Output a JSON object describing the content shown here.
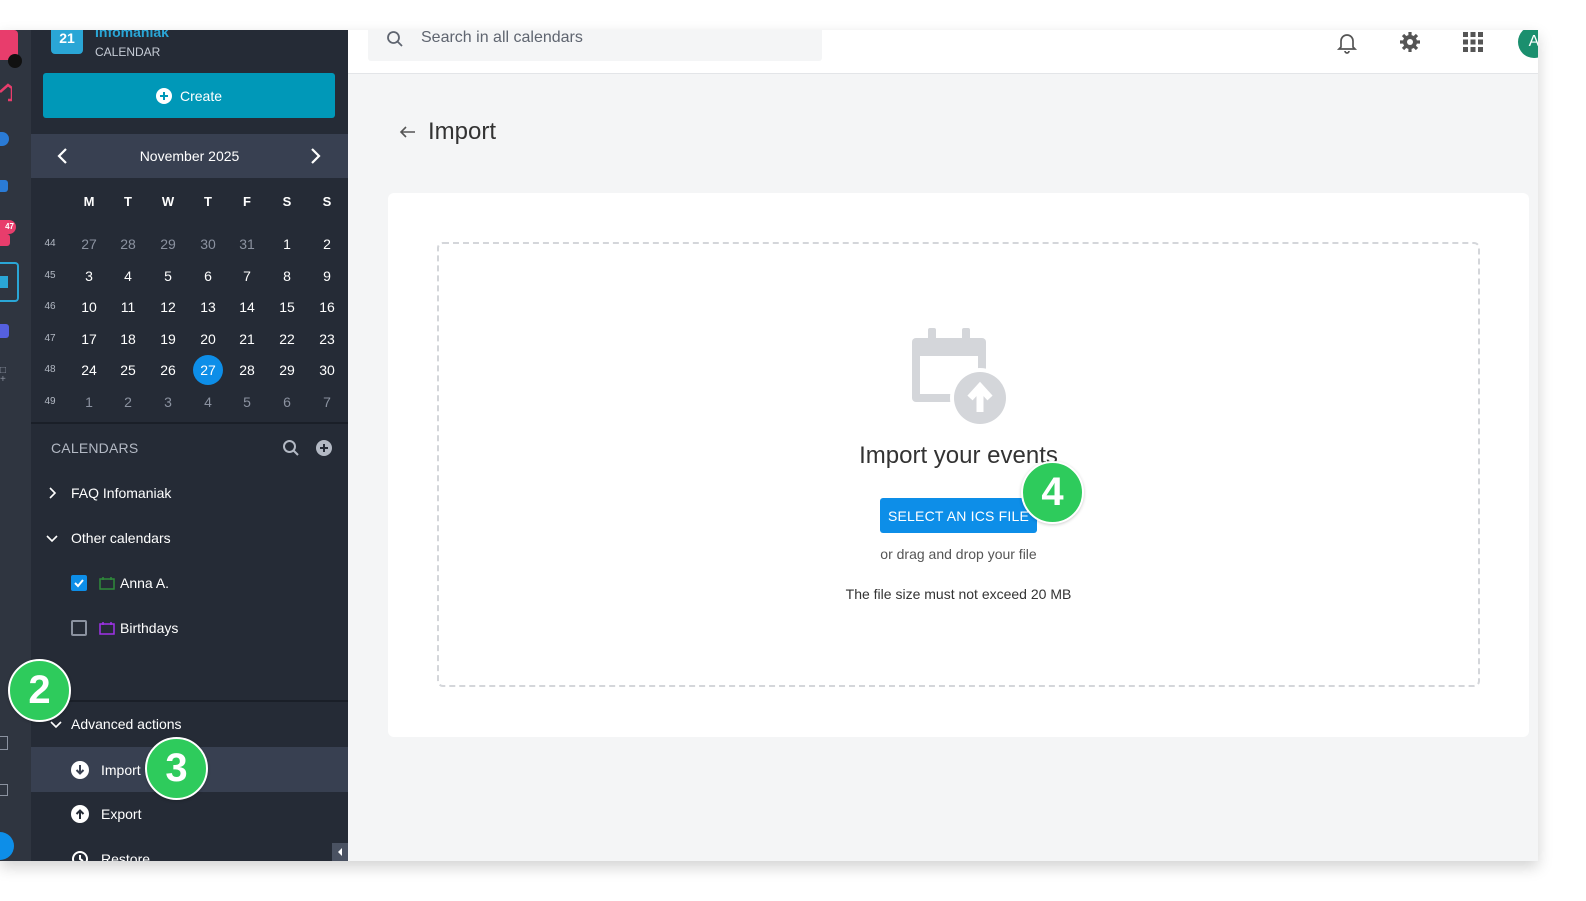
{
  "brand": {
    "logo_text": "21",
    "name": "Infomaniak",
    "subtitle": "CALENDAR"
  },
  "rail": {
    "notification_badge": "47"
  },
  "sidebar": {
    "create_label": "Create",
    "month_label": "November  2025",
    "weekday_headers": [
      "M",
      "T",
      "W",
      "T",
      "F",
      "S",
      "S"
    ],
    "weeks": [
      {
        "num": "44",
        "days": [
          {
            "d": "27",
            "dim": true
          },
          {
            "d": "28",
            "dim": true
          },
          {
            "d": "29",
            "dim": true
          },
          {
            "d": "30",
            "dim": true
          },
          {
            "d": "31",
            "dim": true
          },
          {
            "d": "1"
          },
          {
            "d": "2"
          }
        ]
      },
      {
        "num": "45",
        "days": [
          {
            "d": "3"
          },
          {
            "d": "4"
          },
          {
            "d": "5"
          },
          {
            "d": "6"
          },
          {
            "d": "7"
          },
          {
            "d": "8"
          },
          {
            "d": "9"
          }
        ]
      },
      {
        "num": "46",
        "days": [
          {
            "d": "10"
          },
          {
            "d": "11"
          },
          {
            "d": "12"
          },
          {
            "d": "13"
          },
          {
            "d": "14"
          },
          {
            "d": "15"
          },
          {
            "d": "16"
          }
        ]
      },
      {
        "num": "47",
        "days": [
          {
            "d": "17"
          },
          {
            "d": "18"
          },
          {
            "d": "19"
          },
          {
            "d": "20"
          },
          {
            "d": "21"
          },
          {
            "d": "22"
          },
          {
            "d": "23"
          }
        ]
      },
      {
        "num": "48",
        "days": [
          {
            "d": "24"
          },
          {
            "d": "25"
          },
          {
            "d": "26"
          },
          {
            "d": "27",
            "today": true
          },
          {
            "d": "28"
          },
          {
            "d": "29"
          },
          {
            "d": "30"
          }
        ]
      },
      {
        "num": "49",
        "days": [
          {
            "d": "1",
            "dim": true
          },
          {
            "d": "2",
            "dim": true
          },
          {
            "d": "3",
            "dim": true
          },
          {
            "d": "4",
            "dim": true
          },
          {
            "d": "5",
            "dim": true
          },
          {
            "d": "6",
            "dim": true
          },
          {
            "d": "7",
            "dim": true
          }
        ]
      }
    ],
    "calendars_title": "CALENDARS",
    "groups": [
      {
        "label": "FAQ Infomaniak",
        "expanded": false
      },
      {
        "label": "Other calendars",
        "expanded": true
      }
    ],
    "calendar_items": [
      {
        "label": "Anna A.",
        "checked": true,
        "color": "#2e8b3a"
      },
      {
        "label": "Birthdays",
        "checked": false,
        "color": "#a033e8"
      }
    ],
    "advanced": {
      "label": "Advanced actions",
      "items": [
        {
          "label": "Import",
          "icon": "download-circle-icon",
          "active": true
        },
        {
          "label": "Export",
          "icon": "upload-circle-icon",
          "active": false
        },
        {
          "label": "Restore",
          "icon": "history-icon",
          "active": false
        }
      ]
    }
  },
  "topbar": {
    "search_placeholder": "Search in all calendars",
    "avatar_initial": "A"
  },
  "main": {
    "page_title": "Import",
    "import_heading": "Import your events",
    "select_button": "SELECT AN ICS FILE",
    "drag_text": "or drag and drop your file",
    "size_note": "The file size must not exceed 20 MB"
  },
  "steps": [
    "2",
    "3",
    "4"
  ],
  "colors": {
    "accent": "#0d8ee8",
    "create": "#0098b8",
    "sidebar_bg": "#252b36",
    "step_green": "#2ecb5c",
    "brand": "#2aa6d6"
  }
}
